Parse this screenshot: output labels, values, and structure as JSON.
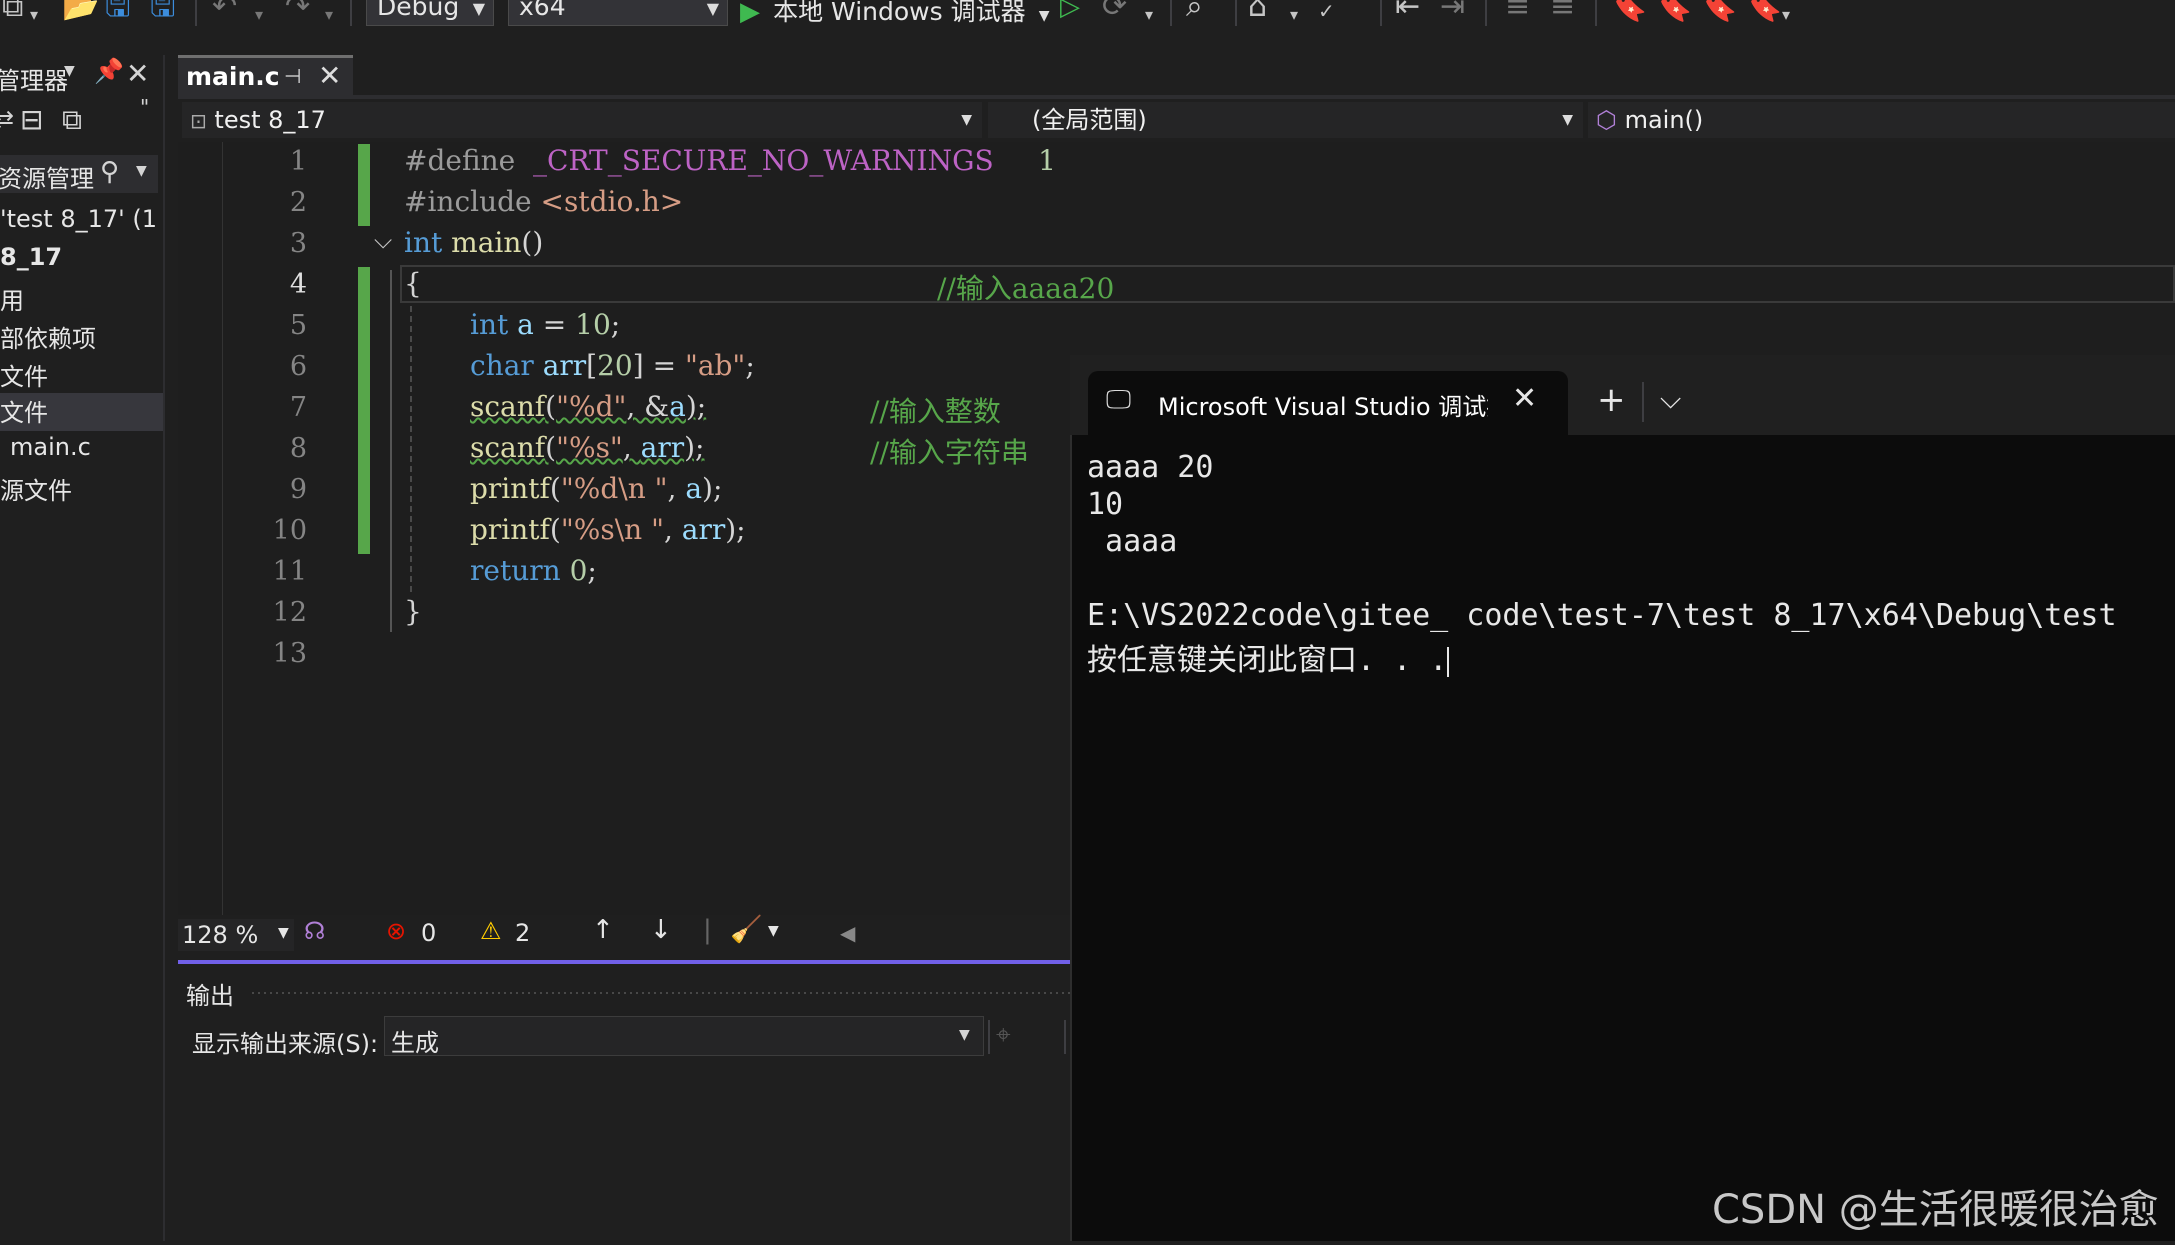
{
  "toolbar": {
    "config": "Debug",
    "platform": "x64",
    "run_label": "本地 Windows 调试器"
  },
  "solution_explorer": {
    "title": "管理器",
    "search_placeholder": "资源管理",
    "items": [
      {
        "label": "'test 8_17' (1"
      },
      {
        "label": "8_17"
      },
      {
        "label": "用"
      },
      {
        "label": "部依赖项"
      },
      {
        "label": "文件"
      },
      {
        "label": "文件"
      },
      {
        "label": "main.c"
      },
      {
        "label": "源文件"
      }
    ]
  },
  "editor": {
    "tab_label": "main.c",
    "project": "test 8_17",
    "scope": "(全局范围)",
    "member": "main()",
    "line_numbers": [
      "1",
      "2",
      "3",
      "4",
      "5",
      "6",
      "7",
      "8",
      "9",
      "10",
      "11",
      "12",
      "13"
    ],
    "code": {
      "l1_pp": "#define",
      "l1_macro": "_CRT_SECURE_NO_WARNINGS",
      "l1_val": "1",
      "l2_pp": "#include",
      "l2_hdr": "<stdio.h>",
      "l3_kw": "int",
      "l3_fn": "main",
      "l3_par": "()",
      "l4_brace": "{",
      "l4_cmt": "//输入aaaa20",
      "l5_kw": "int",
      "l5_var": "a",
      "l5_eq": " = ",
      "l5_num": "10",
      "l5_end": ";",
      "l6_kw": "char",
      "l6_var": "arr",
      "l6_lb": "[",
      "l6_num": "20",
      "l6_rb": "] = ",
      "l6_str": "\"ab\"",
      "l6_end": ";",
      "l7_fn": "scanf",
      "l7_op": "(",
      "l7_str": "\"%d\"",
      "l7_mid": ", &",
      "l7_var": "a",
      "l7_end": ");",
      "l7_cmt": "//输入整数",
      "l8_fn": "scanf",
      "l8_op": "(",
      "l8_str": "\"%s\"",
      "l8_mid": ", ",
      "l8_var": "arr",
      "l8_end": ");",
      "l8_cmt": "//输入字符串",
      "l9_fn": "printf",
      "l9_op": "(",
      "l9_str": "\"%d\\n \"",
      "l9_mid": ", ",
      "l9_var": "a",
      "l9_end": ");",
      "l10_fn": "printf",
      "l10_op": "(",
      "l10_str": "\"%s\\n \"",
      "l10_mid": ", ",
      "l10_var": "arr",
      "l10_end": ");",
      "l11_kw": "return",
      "l11_num": "0",
      "l11_end": ";",
      "l12_brace": "}"
    },
    "zoom": "128 %",
    "errors": "0",
    "warnings": "2"
  },
  "output": {
    "title": "输出",
    "source_label": "显示输出来源(S):",
    "source_value": "生成"
  },
  "terminal": {
    "tab_title": "Microsoft Visual Studio 调试控",
    "lines": [
      "aaaa 20",
      "10",
      " aaaa",
      "",
      "E:\\VS2022code\\gitee_ code\\test-7\\test 8_17\\x64\\Debug\\test",
      "按任意键关闭此窗口. . ."
    ]
  },
  "watermark": "CSDN @生活很暖很治愈",
  "colors": {
    "accent": "#7160e8",
    "change_bar": "#57a64a",
    "keyword": "#569cd6",
    "comment": "#57a64a",
    "string": "#d69d85",
    "error": "#e51400",
    "warning": "#ffcc00"
  }
}
